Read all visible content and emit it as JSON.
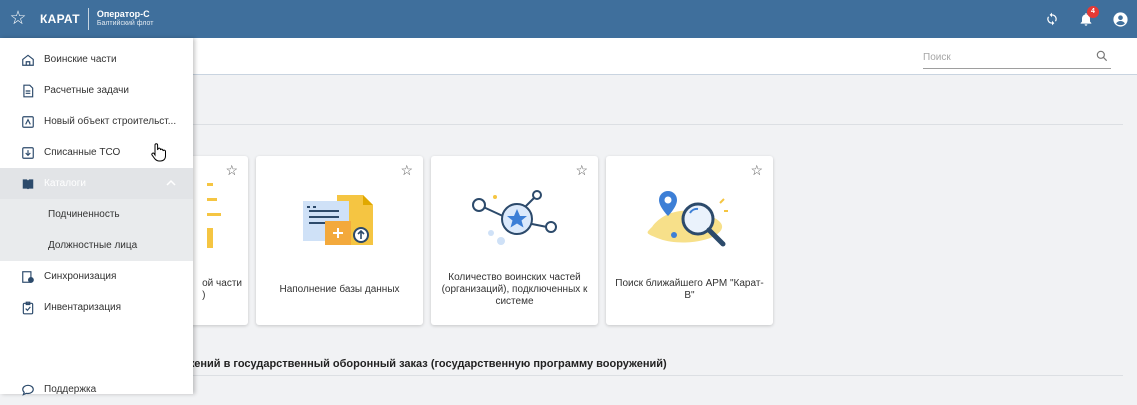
{
  "header": {
    "brand": "КАРАТ",
    "operator": "Оператор-С",
    "fleet": "Балтийский флот",
    "notifications_count": "4"
  },
  "search": {
    "placeholder": "Поиск"
  },
  "sidebar": {
    "items": [
      {
        "label": "Воинские части",
        "icon": "home-icon"
      },
      {
        "label": "Расчетные задачи",
        "icon": "document-icon"
      },
      {
        "label": "Новый объект строительст...",
        "icon": "upload-box-icon"
      },
      {
        "label": "Списанные ТСО",
        "icon": "download-box-icon"
      },
      {
        "label": "Каталоги",
        "icon": "book-icon",
        "expanded": true,
        "children": [
          {
            "label": "Подчиненность"
          },
          {
            "label": "Должностные лица"
          }
        ]
      },
      {
        "label": "Синхронизация",
        "icon": "sync-doc-icon"
      },
      {
        "label": "Инвентаризация",
        "icon": "clipboard-icon"
      }
    ],
    "support": "Поддержка"
  },
  "cards": [
    {
      "title": "ой части\n)"
    },
    {
      "title": "Наполнение базы данных",
      "icon": "database-fill-icon"
    },
    {
      "title": "Количество воинских частей (организаций), подключенных к системе",
      "icon": "network-star-icon"
    },
    {
      "title": "Поиск ближайшего АРМ \"Карат-В\"",
      "icon": "map-search-icon"
    }
  ],
  "section": {
    "title": "ожений в государственный оборонный заказ (государственную программу вооружений)"
  },
  "colors": {
    "header": "#3f6f9c",
    "accent_yellow": "#f5c542",
    "accent_blue": "#3d7fd6"
  }
}
